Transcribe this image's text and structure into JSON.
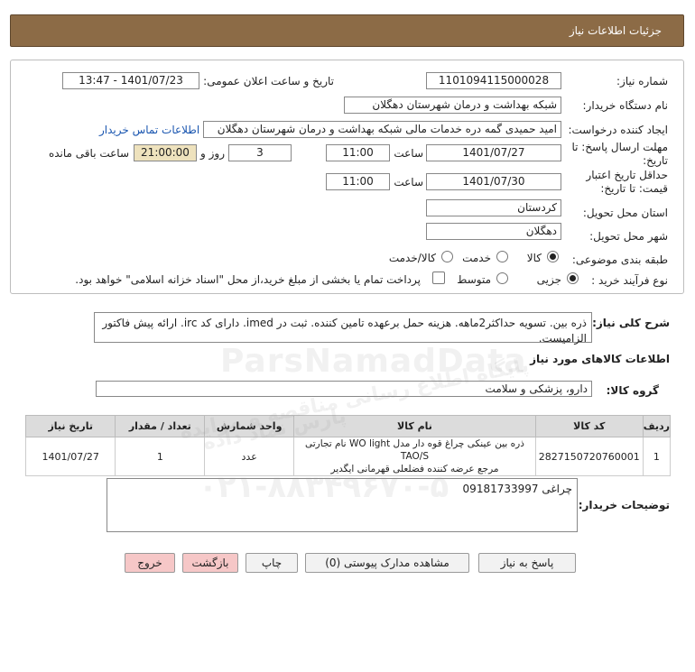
{
  "header": {
    "title": "جزئیات اطلاعات نیاز"
  },
  "form": {
    "need_number_label": "شماره نیاز:",
    "need_number": "1101094115000028",
    "announce_label": "تاریخ و ساعت اعلان عمومی:",
    "announce_value": "1401/07/23 - 13:47",
    "buyer_label": "نام دستگاه خریدار:",
    "buyer_value": "شبکه بهداشت و درمان شهرستان دهگلان",
    "creator_label": "ایجاد کننده درخواست:",
    "creator_value": "امید حمیدی گمه دره خدمات مالی شبکه بهداشت و درمان شهرستان دهگلان",
    "contact_link": "اطلاعات تماس خریدار",
    "deadline_label_1": "مهلت ارسال پاسخ: تا",
    "deadline_label_2": "تاریخ:",
    "deadline_date": "1401/07/27",
    "time_label": "ساعت",
    "deadline_time": "11:00",
    "days_value": "3",
    "days_label": "روز و",
    "remaining_value": "21:00:00",
    "remaining_label": "ساعت باقی مانده",
    "validity_label_1": "حداقل تاریخ اعتبار",
    "validity_label_2": "قیمت: تا تاریخ:",
    "validity_date": "1401/07/30",
    "validity_time_label": "ساعت",
    "validity_time": "11:00",
    "province_label": "استان محل تحویل:",
    "province_value": "کردستان",
    "city_label": "شهر محل تحویل:",
    "city_value": "دهگلان",
    "category_label": "طبقه بندی موضوعی:",
    "category_options": [
      "کالا",
      "خدمت",
      "کالا/خدمت"
    ],
    "category_selected": "کالا",
    "process_label": "نوع فرآیند خرید :",
    "process_options": [
      "جزیی",
      "متوسط"
    ],
    "process_selected": "جزیی",
    "treasury_text": "پرداخت تمام یا بخشی از مبلغ خرید،از محل \"اسناد خزانه اسلامی\" خواهد بود."
  },
  "description": {
    "label": "شرح کلی نیاز:",
    "text": "ذره بین. تسویه حداکثر2ماهه. هزینه حمل برعهده تامین کننده. ثبت در imed. دارای کد irc. ارائه پیش فاکتور الزامیست."
  },
  "goods": {
    "title": "اطلاعات کالاهای مورد نیاز",
    "group_label": "گروه کالا:",
    "group_value": "دارو، پزشکی و سلامت",
    "columns": [
      "ردیف",
      "کد کالا",
      "نام کالا",
      "واحد شمارش",
      "تعداد / مقدار",
      "تاریخ نیاز"
    ],
    "rows": [
      {
        "row": "1",
        "code": "2827150720760001",
        "name_line1": "ذره بین عینکی چراغ قوه دار مدل WO light نام تجارتی TAO/S",
        "name_line2": "مرجع عرضه کننده فضلعلی قهرمانی ایگدیر",
        "unit": "عدد",
        "qty": "1",
        "date": "1401/07/27"
      }
    ]
  },
  "buyer_notes": {
    "label": "توضیحات خریدار:",
    "text": "چراغی 09181733997"
  },
  "buttons": {
    "reply": "پاسخ به نیاز",
    "attachments": "مشاهده مدارک پیوستی (0)",
    "print": "چاپ",
    "back": "بازگشت",
    "exit": "خروج"
  },
  "watermark": {
    "brand": "ParsNamadData",
    "line1": "پایگاه اطلاع رسانی مناقصه و مزایده",
    "line2": "پارس نماد داده",
    "phone": "۰۲۱-۸۸۳۴۹۶۷۰-۵"
  }
}
